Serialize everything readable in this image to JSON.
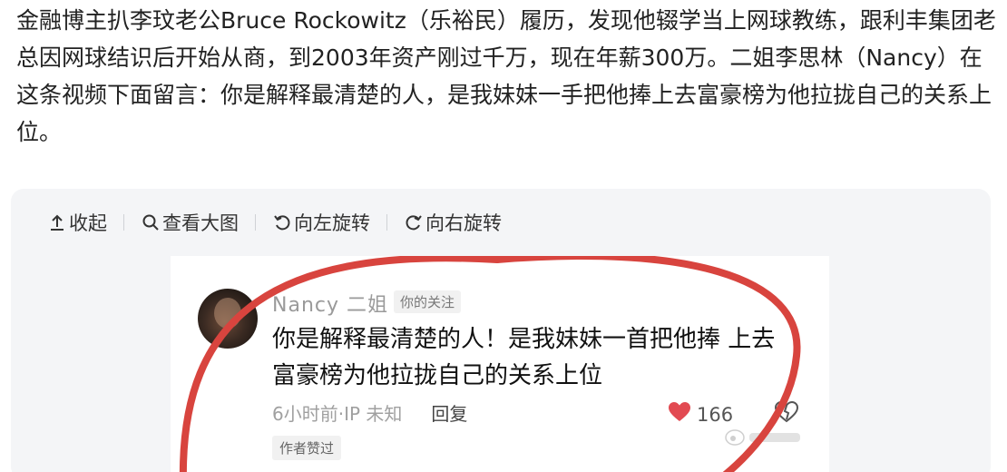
{
  "article": {
    "text": "金融博主扒李玟老公Bruce Rockowitz（乐裕民）履历，发现他辍学当上网球教练，跟利丰集团老总因网球结识后开始从商，到2003年资产刚过千万，现在年薪300万。二姐李思林（Nancy）在这条视频下面留言：你是解释最清楚的人，是我妹妹一手把他捧上去富豪榜为他拉拢自己的关系上位。"
  },
  "toolbar": {
    "collapse_label": "收起",
    "view_large_label": "查看大图",
    "rotate_left_label": "向左旋转",
    "rotate_right_label": "向右旋转"
  },
  "comment": {
    "username": "Nancy 二姐",
    "follow_badge": "你的关注",
    "text": "你是解释最清楚的人！是我妹妹一首把他捧 上去富豪榜为他拉拢自己的关系上位",
    "time": "6小时前",
    "ip": "·IP 未知",
    "reply_label": "回复",
    "like_count": "166",
    "author_liked": "作者赞过",
    "accent_red": "#d8443e"
  }
}
